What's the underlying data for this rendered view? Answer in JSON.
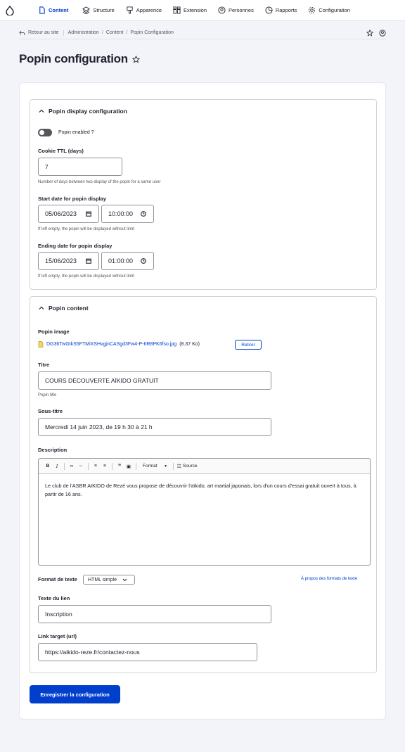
{
  "toolbar": {
    "items": [
      {
        "label": "Content",
        "icon": "file-icon",
        "active": true
      },
      {
        "label": "Structure",
        "icon": "layers-icon"
      },
      {
        "label": "Apparence",
        "icon": "brush-icon"
      },
      {
        "label": "Extension",
        "icon": "puzzle-icon"
      },
      {
        "label": "Personnes",
        "icon": "person-icon"
      },
      {
        "label": "Rapports",
        "icon": "chart-icon"
      },
      {
        "label": "Configuration",
        "icon": "gear-icon"
      }
    ]
  },
  "breadcrumb": {
    "back": "Retour au site",
    "items": [
      "Administration",
      "Content",
      "Popin Configuration"
    ]
  },
  "page": {
    "title": "Popin configuration"
  },
  "display_section": {
    "title": "Popin display configuration",
    "toggle_label": "Popin enabled ?",
    "cookie_label": "Cookie TTL (days)",
    "cookie_value": "7",
    "cookie_desc": "Number of days between two display of the popin for a same user",
    "start_label": "Start date for popin display",
    "start_date": "05/06/2023",
    "start_time": "10:00:00",
    "start_desc": "If left empty, the popin will be displayed without limit",
    "end_label": "Ending date for popin display",
    "end_date": "15/06/2023",
    "end_time": "01:00:00",
    "end_desc": "If left empty, the popin will be displayed without limit"
  },
  "content_section": {
    "title": "Popin content",
    "image_label": "Popin image",
    "image_name": "DG36TwGtkS5FTMiXSHvgjnCASgd3Fw4-P-6R8PK6fso.jpg",
    "image_size": "(8.37 Ko)",
    "remove_label": "Retirer",
    "titre_label": "Titre",
    "titre_value": "COURS DÉCOUVERTE AÏKIDO GRATUIT",
    "titre_desc": "Popin title",
    "soustitre_label": "Sous-titre",
    "soustitre_value": "Mercredi 14 juin 2023, de 19 h 30 à 21 h",
    "description_label": "Description",
    "editor_format": "Format",
    "editor_source": "Source",
    "description_text": "Le club de l'ASBR AIKIDO de Rezé vous propose de découvrir l'aïkido, art martial japonais, lors d'un cours d'essai gratuit ouvert à tous, à partir de 16 ans.",
    "text_format_label": "Format de texte",
    "text_format_value": "HTML simple",
    "text_format_link": "À propos des formats de texte",
    "link_text_label": "Texte du lien",
    "link_text_value": "Inscription",
    "link_target_label": "Link target (url)",
    "link_target_value": "https://aikido-reze.fr/contactez-nous"
  },
  "actions": {
    "save": "Enregistrer la configuration"
  },
  "colors": {
    "primary": "#003ecc",
    "text": "#222330"
  }
}
